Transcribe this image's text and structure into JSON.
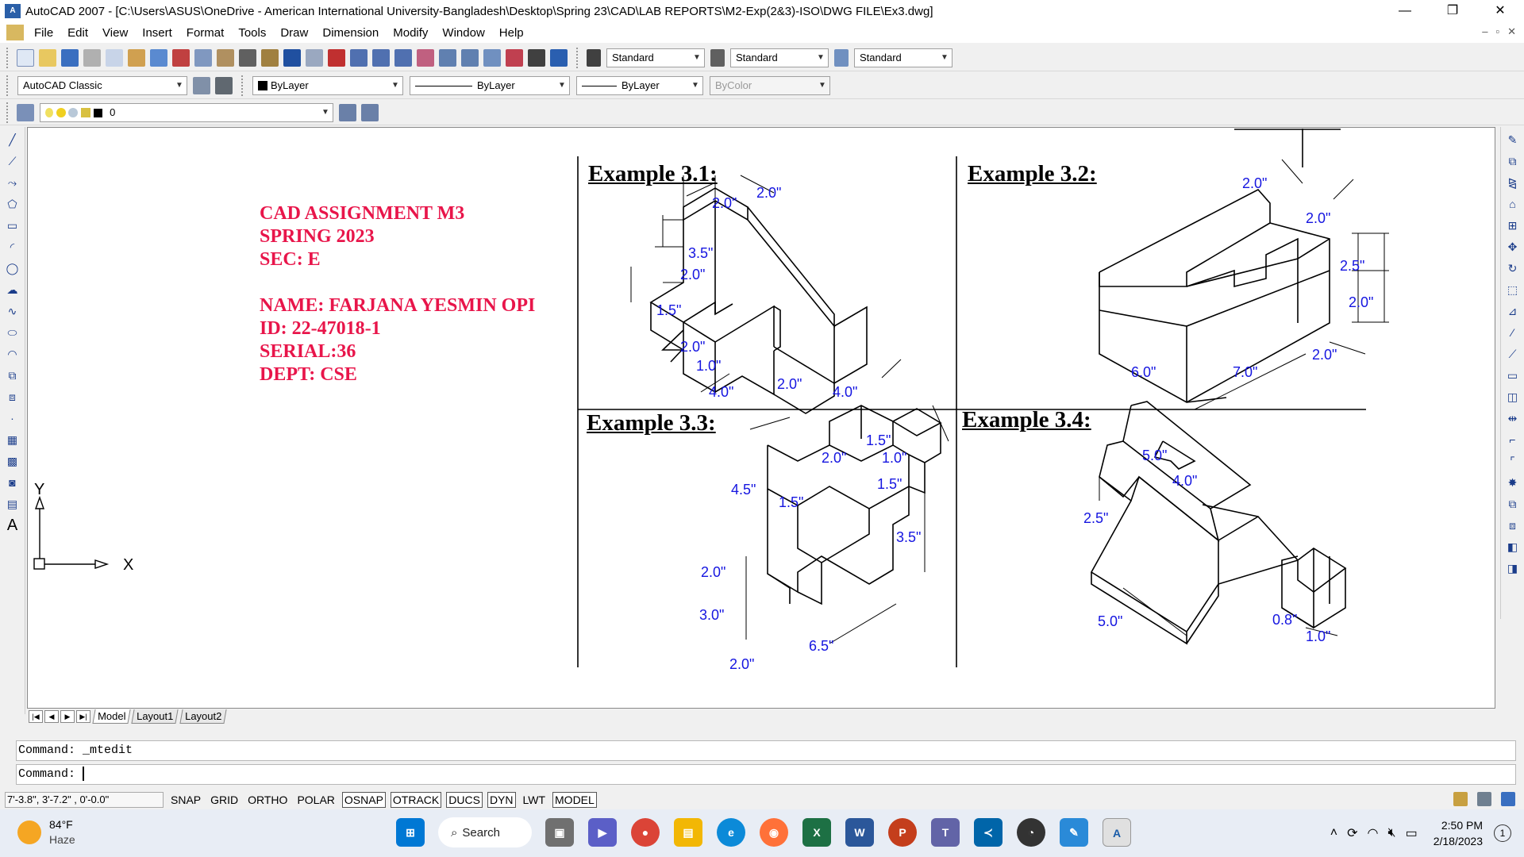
{
  "window": {
    "title": "AutoCAD 2007 - [C:\\Users\\ASUS\\OneDrive - American International University-Bangladesh\\Desktop\\Spring 23\\CAD\\LAB REPORTS\\M2-Exp(2&3)-ISO\\DWG FILE\\Ex3.dwg]",
    "minimize": "—",
    "restore": "❐",
    "close": "✕",
    "doc_minimize": "–",
    "doc_restore": "▫",
    "doc_close": "✕"
  },
  "menu": [
    "File",
    "Edit",
    "View",
    "Insert",
    "Format",
    "Tools",
    "Draw",
    "Dimension",
    "Modify",
    "Window",
    "Help"
  ],
  "styles_toolbar": {
    "text_style": "Standard",
    "dim_style": "Standard",
    "table_style": "Standard"
  },
  "properties_toolbar": {
    "workspace": "AutoCAD Classic",
    "color": "ByLayer",
    "linetype": "ByLayer",
    "lineweight": "ByLayer",
    "plot_style": "ByColor"
  },
  "layers_toolbar": {
    "current_layer": "0"
  },
  "drawing": {
    "info_lines": [
      "CAD ASSIGNMENT M3",
      "SPRING 2023",
      "SEC: E",
      "",
      "NAME: FARJANA YESMIN OPI",
      "ID: 22-47018-1",
      "SERIAL:36",
      "DEPT: CSE"
    ],
    "examples": [
      "Example 3.1:",
      "Example 3.2:",
      "Example 3.3:",
      "Example 3.4:"
    ],
    "dims_31": [
      "2.0\"",
      "2.0\"",
      "3.5\"",
      "2.0\"",
      "1.5\"",
      "2.0\"",
      "1.0\"",
      "4.0\"",
      "2.0\"",
      "4.0\""
    ],
    "dims_32": [
      "2.0\"",
      "2.0\"",
      "2.5\"",
      "2.0\"",
      "2.0\"",
      "6.0\"",
      "7.0\""
    ],
    "dims_33": [
      "1.5\"",
      "2.0\"",
      "1.0\"",
      "1.5\"",
      "4.5\"",
      "1.5\"",
      "3.5\"",
      "2.0\"",
      "3.0\"",
      "6.5\"",
      "2.0\""
    ],
    "dims_34": [
      "5.0\"",
      "4.0\"",
      "2.5\"",
      "5.0\"",
      "0.8\"",
      "1.0\""
    ],
    "ucs_x": "X",
    "ucs_y": "Y"
  },
  "layout_tabs": [
    "Model",
    "Layout1",
    "Layout2"
  ],
  "command": {
    "history": "Command:  _mtedit",
    "prompt": "Command:"
  },
  "status": {
    "coords": "7'-3.8\",  3'-7.2\" , 0'-0.0\"",
    "buttons": [
      {
        "label": "SNAP",
        "on": false
      },
      {
        "label": "GRID",
        "on": false
      },
      {
        "label": "ORTHO",
        "on": false
      },
      {
        "label": "POLAR",
        "on": false
      },
      {
        "label": "OSNAP",
        "on": true
      },
      {
        "label": "OTRACK",
        "on": true
      },
      {
        "label": "DUCS",
        "on": true
      },
      {
        "label": "DYN",
        "on": true
      },
      {
        "label": "LWT",
        "on": false
      },
      {
        "label": "MODEL",
        "on": true
      }
    ]
  },
  "taskbar": {
    "temperature": "84°F",
    "weather": "Haze",
    "search": "Search",
    "time": "2:50 PM",
    "date": "2/18/2023",
    "notifications": "1"
  }
}
